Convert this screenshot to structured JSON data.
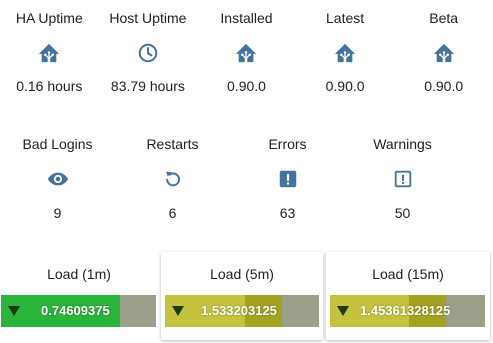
{
  "colors": {
    "icon": "#44739e",
    "load_1m_fill": "#2ab53a",
    "load_5m_fill": "#a3a322",
    "load_15m_fill": "#a3a322",
    "gauge_track": "#9aa08a"
  },
  "stats_row1": [
    {
      "label": "HA Uptime",
      "icon": "home-assistant-icon",
      "value": "0.16 hours"
    },
    {
      "label": "Host Uptime",
      "icon": "clock-icon",
      "value": "83.79 hours"
    },
    {
      "label": "Installed",
      "icon": "home-assistant-icon",
      "value": "0.90.0"
    },
    {
      "label": "Latest",
      "icon": "home-assistant-icon",
      "value": "0.90.0"
    },
    {
      "label": "Beta",
      "icon": "home-assistant-icon",
      "value": "0.90.0"
    }
  ],
  "stats_row2": [
    {
      "label": "Bad Logins",
      "icon": "eye-icon",
      "value": "9"
    },
    {
      "label": "Restarts",
      "icon": "restart-icon",
      "value": "6"
    },
    {
      "label": "Errors",
      "icon": "alert-box-icon",
      "value": "63"
    },
    {
      "label": "Warnings",
      "icon": "alert-box-outline-icon",
      "value": "50"
    }
  ],
  "loads": [
    {
      "label": "Load (1m)",
      "value": "0.74609375",
      "fill_fraction": 0.77
    },
    {
      "label": "Load (5m)",
      "value": "1.533203125",
      "fill_fraction": 0.76
    },
    {
      "label": "Load (15m)",
      "value": "1.45361328125",
      "fill_fraction": 0.75
    }
  ]
}
